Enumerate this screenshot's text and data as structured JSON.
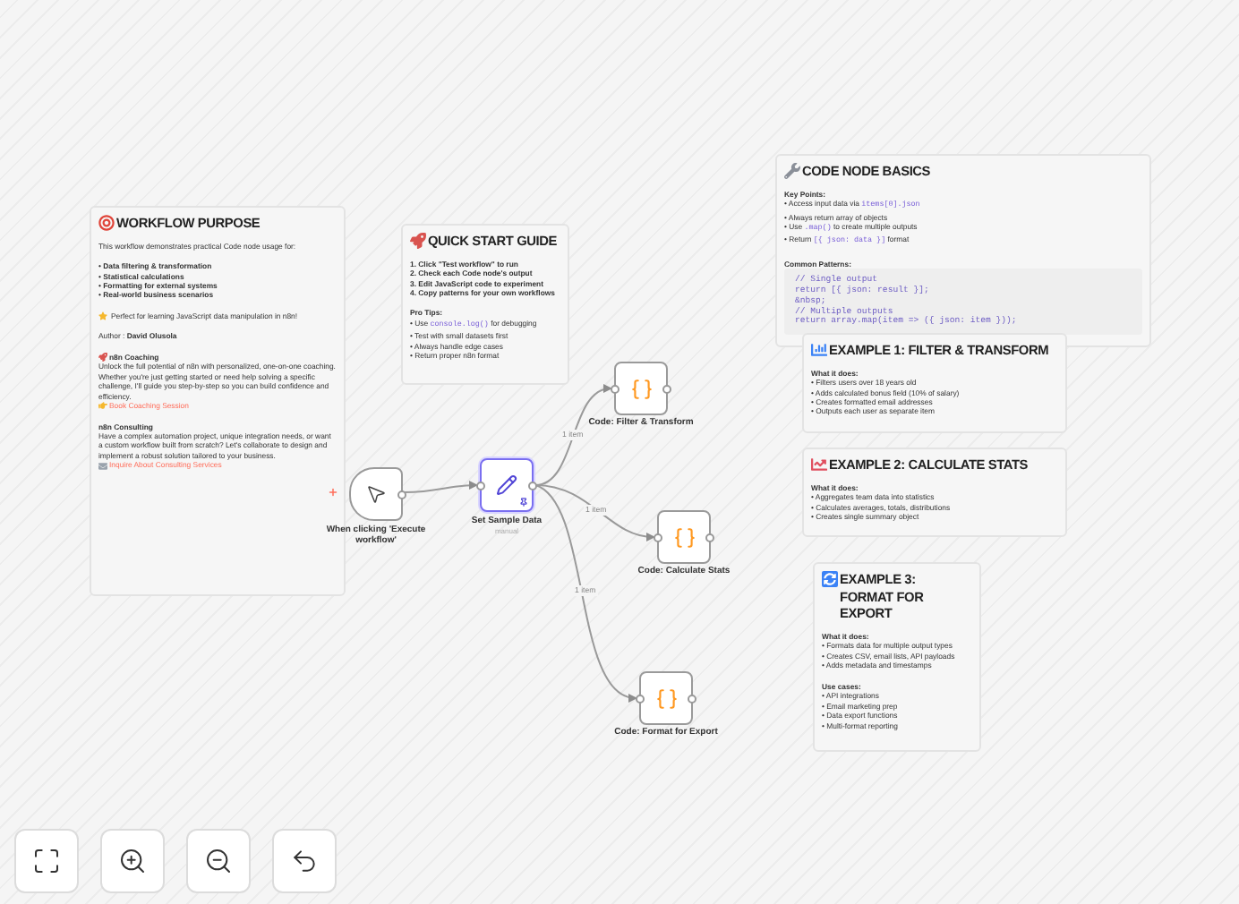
{
  "notes": [
    {
      "title": "WORKFLOW PURPOSE",
      "blocks": [
        {
          "kind": "p",
          "text": "This workflow demonstrates practical Code node usage for:"
        },
        {
          "kind": "list_bold",
          "items": [
            "• Data filtering & transformation",
            "• Statistical calculations",
            "• Formatting for external systems",
            "• Real-world business scenarios"
          ]
        },
        {
          "kind": "tip",
          "text": "Perfect for learning JavaScript data manipulation in n8n!"
        },
        {
          "kind": "p",
          "text": "Author : **David Olusola**"
        },
        {
          "kind": "icon_heading",
          "text": "n8n Coaching"
        },
        {
          "kind": "p_tight",
          "text": "Unlock the full potential of n8n with personalized, one-on-one coaching. Whether you're just getting started or need help solving a specific challenge, I'll guide you step-by-step so you can build confidence and efficiency."
        },
        {
          "kind": "link",
          "text": "Book Coaching Session"
        },
        {
          "kind": "heading",
          "text": "n8n Consulting"
        },
        {
          "kind": "p_tight",
          "text": "Have a complex automation project, unique integration needs, or want a custom workflow built from scratch? Let's collaborate to design and implement a robust solution tailored to your business."
        },
        {
          "kind": "mail_link",
          "text": "Inquire About Consulting Services"
        }
      ]
    },
    {
      "title": "QUICK START GUIDE",
      "blocks": [
        {
          "kind": "list_bold",
          "items": [
            "1. Click \"Test workflow\" to run",
            "2. Check each Code node's output",
            "3. Edit JavaScript code to experiment",
            "4. Copy patterns for your own workflows"
          ]
        },
        {
          "kind": "heading",
          "text": "Pro Tips:"
        },
        {
          "kind": "list",
          "items": [
            {
              "parts": [
                {
                  "text": "• Use "
                },
                {
                  "code": "console.log()"
                },
                {
                  "text": " for debugging"
                }
              ]
            },
            "• Test with small datasets first",
            "• Always handle edge cases",
            "• Return proper n8n format"
          ]
        }
      ]
    },
    {
      "title": "CODE NODE BASICS",
      "blocks": [
        {
          "kind": "heading",
          "text": "Key Points:"
        },
        {
          "kind": "list",
          "items": [
            {
              "parts": [
                {
                  "text": "• Access input data via "
                },
                {
                  "code": "items[0].json"
                }
              ]
            },
            "• Always return array of objects",
            {
              "parts": [
                {
                  "text": "• Use "
                },
                {
                  "code": ".map()"
                },
                {
                  "text": " to create multiple outputs"
                }
              ]
            },
            {
              "parts": [
                {
                  "text": "• Return "
                },
                {
                  "code": "[{ json: data }]"
                },
                {
                  "text": " format"
                }
              ]
            }
          ]
        },
        {
          "kind": "heading",
          "text": "Common Patterns:"
        },
        {
          "kind": "code",
          "items": [
            "// Single output",
            "return [{ json: result }];",
            "&nbsp;",
            "// Multiple outputs",
            "return array.map(item => ({ json: item }));"
          ]
        }
      ]
    },
    {
      "title": "EXAMPLE 1: FILTER & TRANSFORM",
      "blocks": [
        {
          "kind": "heading",
          "text": "What it does:"
        },
        {
          "kind": "list",
          "items": [
            "• Filters users over 18 years old",
            "• Adds calculated bonus field (10% of salary)",
            "• Creates formatted email addresses",
            "• Outputs each user as separate item"
          ]
        }
      ]
    },
    {
      "title": "EXAMPLE 2: CALCULATE STATS",
      "blocks": [
        {
          "kind": "heading",
          "text": "What it does:"
        },
        {
          "kind": "list",
          "items": [
            "• Aggregates team data into statistics",
            "• Calculates averages, totals, distributions",
            "• Creates single summary object"
          ]
        }
      ]
    },
    {
      "title": "EXAMPLE 3: FORMAT FOR EXPORT",
      "blocks": [
        {
          "kind": "heading",
          "text": "What it does:"
        },
        {
          "kind": "list",
          "items": [
            "• Formats data for multiple output types",
            "• Creates CSV, email lists, API payloads",
            "• Adds metadata and timestamps"
          ]
        },
        {
          "kind": "heading",
          "text": "Use cases:"
        },
        {
          "kind": "list",
          "items": [
            "• API integrations",
            "• Email marketing prep",
            "• Data export functions",
            "• Multi-format reporting"
          ]
        }
      ]
    }
  ],
  "nodes": [
    {
      "kind": "trigger",
      "label": "When clicking 'Execute workflow'",
      "selected": false
    },
    {
      "kind": "set",
      "label": "Set Sample Data",
      "subtitle": "manual",
      "selected": true
    },
    {
      "kind": "code",
      "label": "Code: Filter & Transform",
      "selected": false
    },
    {
      "kind": "code",
      "label": "Code: Calculate Stats",
      "selected": false
    },
    {
      "kind": "code",
      "label": "Code: Format for Export",
      "selected": false
    }
  ],
  "edges": [
    {
      "kind": "plain"
    },
    {
      "kind": "labeled",
      "label": "1 item"
    },
    {
      "kind": "labeled",
      "label": "1 item"
    },
    {
      "kind": "labeled",
      "label": "1 item"
    }
  ],
  "controls": [
    {
      "kind": "fit"
    },
    {
      "kind": "zoom_in"
    },
    {
      "kind": "zoom_out"
    },
    {
      "kind": "undo"
    }
  ]
}
